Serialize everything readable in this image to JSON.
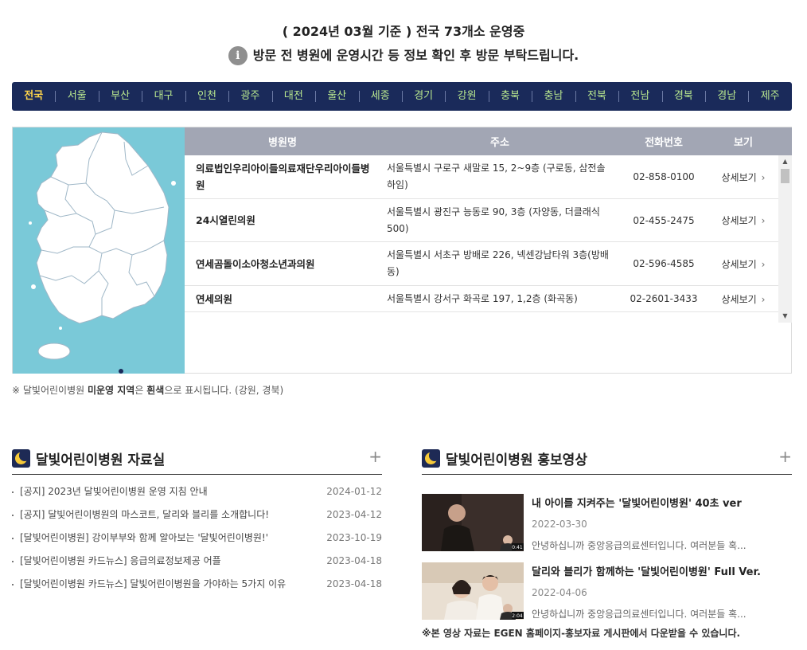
{
  "header": {
    "line1": "( 2024년 03월 기준 ) 전국 73개소 운영중",
    "info_icon": "i",
    "line2": "방문 전 병원에 운영시간 등 정보 확인 후 방문 부탁드립니다."
  },
  "regions": [
    "전국",
    "서울",
    "부산",
    "대구",
    "인천",
    "광주",
    "대전",
    "울산",
    "세종",
    "경기",
    "강원",
    "충북",
    "충남",
    "전북",
    "전남",
    "경북",
    "경남",
    "제주"
  ],
  "active_region": "전국",
  "table": {
    "headers": [
      "병원명",
      "주소",
      "전화번호",
      "보기"
    ],
    "rows": [
      {
        "name": "의료법인우리아이들의료재단우리아이들병원",
        "address": "서울특별시 구로구 새말로 15, 2~9층 (구로동, 삼전솔하임)",
        "phone": "02-858-0100",
        "view": "상세보기"
      },
      {
        "name": "24시열린의원",
        "address": "서울특별시 광진구 능동로 90, 3층 (자양동, 더클래식500)",
        "phone": "02-455-2475",
        "view": "상세보기"
      },
      {
        "name": "연세곰돌이소아청소년과의원",
        "address": "서울특별시 서초구 방배로 226, 넥센강남타워 3층(방배동)",
        "phone": "02-596-4585",
        "view": "상세보기"
      },
      {
        "name": "연세의원",
        "address": "서울특별시 강서구 화곡로 197, 1,2층 (화곡동)",
        "phone": "02-2601-3433",
        "view": "상세보기"
      }
    ]
  },
  "map_note": {
    "prefix": "※ 달빛어린이병원 ",
    "bold": "미운영 지역",
    "middle": "은 ",
    "bold2": "흰색",
    "suffix": "으로 표시됩니다. (강원, 경북)"
  },
  "archive": {
    "title": "달빛어린이병원 자료실",
    "more": "+",
    "items": [
      {
        "title": "[공지] 2023년 달빛어린이병원 운영 지침 안내",
        "date": "2024-01-12"
      },
      {
        "title": "[공지] 달빛어린이병원의 마스코트, 달리와 블리를 소개합니다!",
        "date": "2023-04-12"
      },
      {
        "title": "[달빛어린이병원] 강이부부와 함께 알아보는 '달빛어린이병원!'",
        "date": "2023-10-19"
      },
      {
        "title": "[달빛어린이병원 카드뉴스] 응급의료정보제공 어플",
        "date": "2023-04-18"
      },
      {
        "title": "[달빛어린이병원 카드뉴스] 달빛어린이병원을 가야하는 5가지 이유",
        "date": "2023-04-18"
      }
    ]
  },
  "videos": {
    "title": "달빛어린이병원 홍보영상",
    "more": "+",
    "items": [
      {
        "title": "내 아이를 지켜주는 '달빛어린이병원' 40초 ver",
        "date": "2022-03-30",
        "summary": "안녕하십니까 중앙응급의료센터입니다. 여러분들 혹...",
        "duration": "0:41"
      },
      {
        "title": "달리와 블리가 함께하는 '달빛어린이병원' Full Ver.",
        "date": "2022-04-06",
        "summary": "안녕하십니까 중앙응급의료센터입니다. 여러분들 혹...",
        "duration": "2:04"
      }
    ],
    "note": "※본 영상 자료는 EGEN 홈페이지-홍보자료 게시판에서 다운받을 수 있습니다."
  }
}
